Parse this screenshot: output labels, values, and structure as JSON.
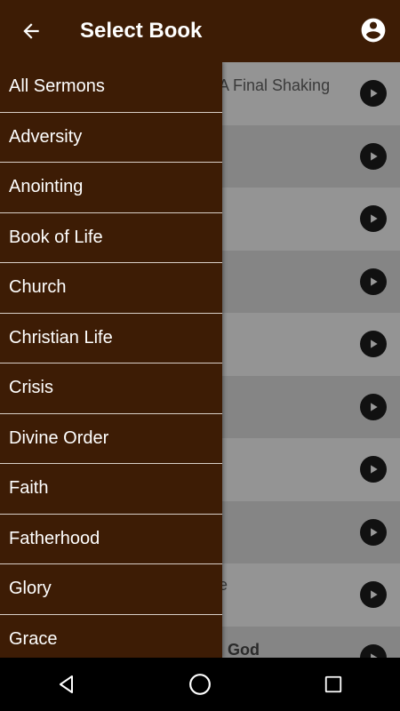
{
  "appbar": {
    "title": "Select Book"
  },
  "drawer": {
    "items": [
      {
        "label": "All Sermons"
      },
      {
        "label": "Adversity"
      },
      {
        "label": "Anointing"
      },
      {
        "label": "Book of Life"
      },
      {
        "label": "Church"
      },
      {
        "label": "Christian Life"
      },
      {
        "label": "Crisis"
      },
      {
        "label": "Divine Order"
      },
      {
        "label": "Faith"
      },
      {
        "label": "Fatherhood"
      },
      {
        "label": "Glory"
      },
      {
        "label": "Grace"
      }
    ]
  },
  "list": {
    "rows": [
      {
        "text": "A Final Shaking"
      },
      {
        "text": ""
      },
      {
        "text": ""
      },
      {
        "text": ""
      },
      {
        "text": ""
      },
      {
        "text": ""
      },
      {
        "text": ""
      },
      {
        "text": ""
      },
      {
        "text": "e"
      },
      {
        "text": "l God"
      }
    ]
  },
  "icons": {
    "back": "arrow-back-icon",
    "account": "account-circle-icon",
    "play": "play-icon",
    "nav_back": "nav-back-icon",
    "nav_home": "nav-home-icon",
    "nav_recents": "nav-recents-icon"
  },
  "colors": {
    "bar": "#3d1c05",
    "drawer": "#3d1c05",
    "divider": "#d9cfc7"
  }
}
